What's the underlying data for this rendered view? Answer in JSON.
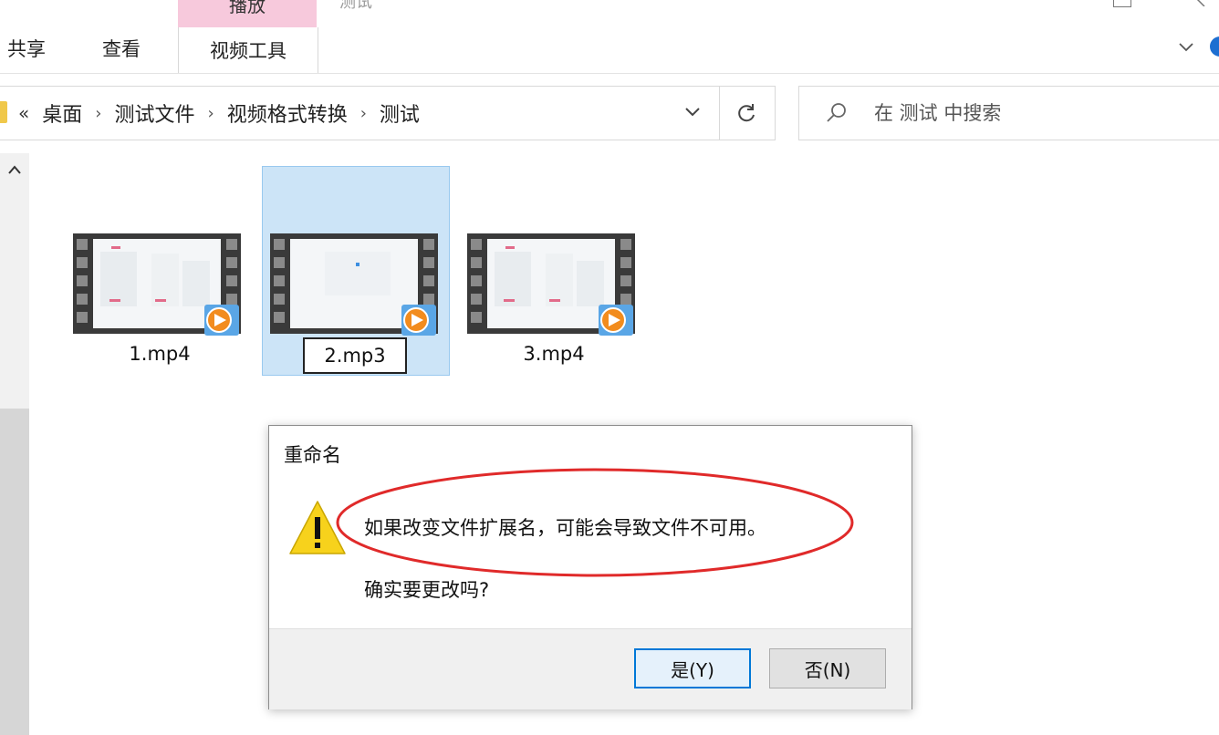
{
  "ribbon": {
    "context_tab_label": "播放",
    "top_title": "测试",
    "tabs": [
      "共享",
      "查看"
    ],
    "context_tab": "视频工具"
  },
  "address": {
    "lead": "«",
    "segments": [
      "桌面",
      "测试文件",
      "视频格式转换",
      "测试"
    ]
  },
  "search": {
    "placeholder": "在 测试 中搜索"
  },
  "files": [
    {
      "name": "1.mp4",
      "selected": false
    },
    {
      "name": "2.mp3",
      "selected": true,
      "renaming": true
    },
    {
      "name": "3.mp4",
      "selected": false
    }
  ],
  "dialog": {
    "title": "重命名",
    "message": "如果改变文件扩展名，可能会导致文件不可用。",
    "question": "确实要更改吗?",
    "yes_label": "是(Y)",
    "no_label": "否(N)"
  },
  "colors": {
    "selection": "#cce4f7",
    "accent": "#0078d7",
    "highlight_ellipse": "#e02a2a",
    "context_tab": "#f7c9dc"
  }
}
